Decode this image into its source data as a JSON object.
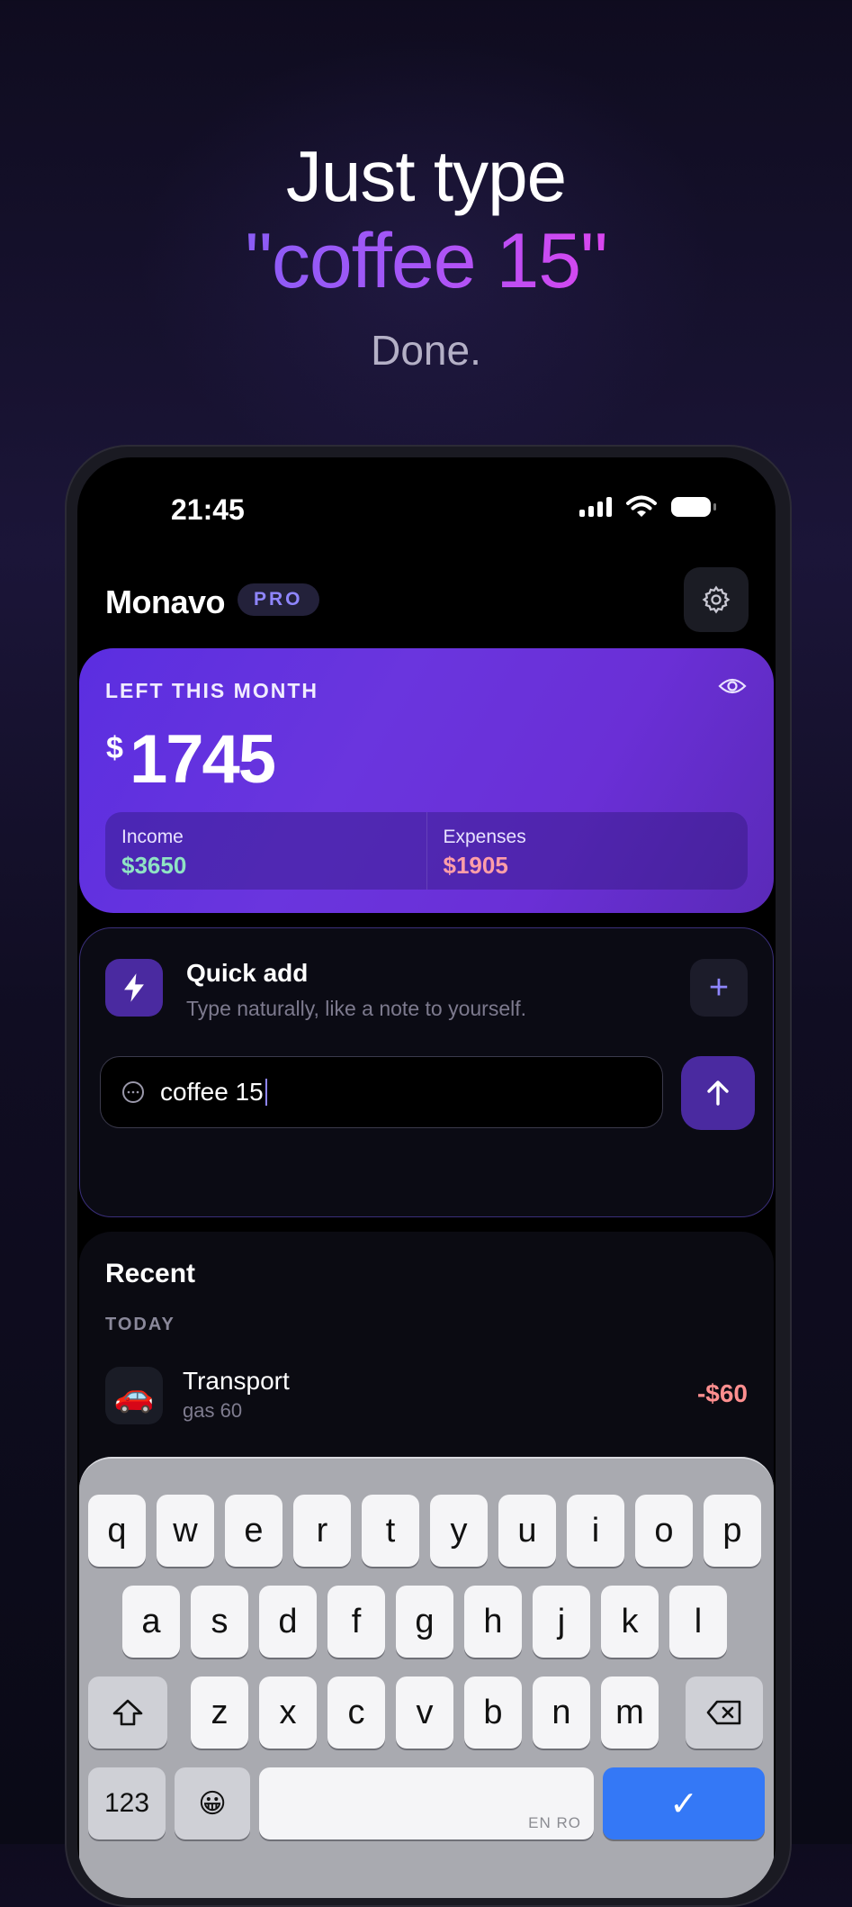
{
  "hero": {
    "line1": "Just type",
    "line2": "\"coffee 15\"",
    "line3": "Done."
  },
  "status_bar": {
    "time": "21:45"
  },
  "header": {
    "app_name": "Monavo",
    "badge": "PRO",
    "settings_icon": "gear-icon"
  },
  "balance": {
    "label": "LEFT THIS MONTH",
    "currency": "$",
    "amount": "1745",
    "income_label": "Income",
    "income_value": "$3650",
    "expenses_label": "Expenses",
    "expenses_value": "$1905",
    "visibility_icon": "eye-icon"
  },
  "quick_add": {
    "title": "Quick add",
    "subtitle": "Type naturally, like a note to yourself.",
    "input_value": "coffee 15",
    "add_icon": "+",
    "send_icon": "arrow-up-icon"
  },
  "recent": {
    "title": "Recent",
    "day": "TODAY",
    "items": [
      {
        "emoji": "🚗",
        "category": "Transport",
        "note": "gas 60",
        "amount": "-$60"
      }
    ]
  },
  "keyboard": {
    "row1": [
      "q",
      "w",
      "e",
      "r",
      "t",
      "y",
      "u",
      "i",
      "o",
      "p"
    ],
    "row2": [
      "a",
      "s",
      "d",
      "f",
      "g",
      "h",
      "j",
      "k",
      "l"
    ],
    "row3": [
      "z",
      "x",
      "c",
      "v",
      "b",
      "n",
      "m"
    ],
    "numbers_key": "123",
    "emoji_key": "😀",
    "language": "EN RO",
    "done_key": "✓"
  },
  "colors": {
    "accent": "#5b2ee0",
    "income": "#8fe3c4",
    "expense": "#ff9ea8",
    "badge": "#8f86ff"
  }
}
